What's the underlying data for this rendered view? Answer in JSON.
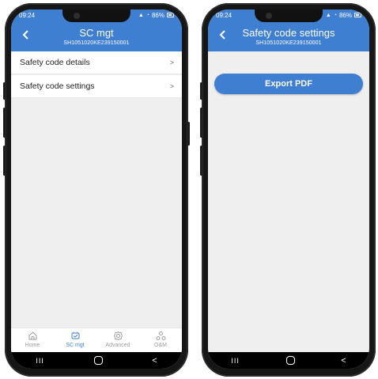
{
  "left_screen": {
    "status": {
      "time": "09:24",
      "battery": "86%"
    },
    "header": {
      "title": "SC mgt",
      "subtitle": "SH1051020KE239150001"
    },
    "list": [
      {
        "label": "Safety code details",
        "chevron": ">"
      },
      {
        "label": "Safety code settings",
        "chevron": ">"
      }
    ],
    "tabs": [
      {
        "label": "Home",
        "icon": "home-icon"
      },
      {
        "label": "SC mgt",
        "icon": "sc-mgt-icon",
        "active": true
      },
      {
        "label": "Advanced",
        "icon": "gear-icon"
      },
      {
        "label": "O&M",
        "icon": "om-icon"
      }
    ],
    "nav": {
      "recents": "III",
      "home": "O",
      "back": "<"
    }
  },
  "right_screen": {
    "status": {
      "time": "09:24",
      "battery": "86%"
    },
    "header": {
      "title": "Safety code settings",
      "subtitle": "SH1051020KE239150001"
    },
    "export_button": "Export PDF",
    "nav": {
      "recents": "III",
      "home": "O",
      "back": "<"
    }
  },
  "colors": {
    "accent": "#3f7fd2",
    "background": "#efeff0"
  }
}
